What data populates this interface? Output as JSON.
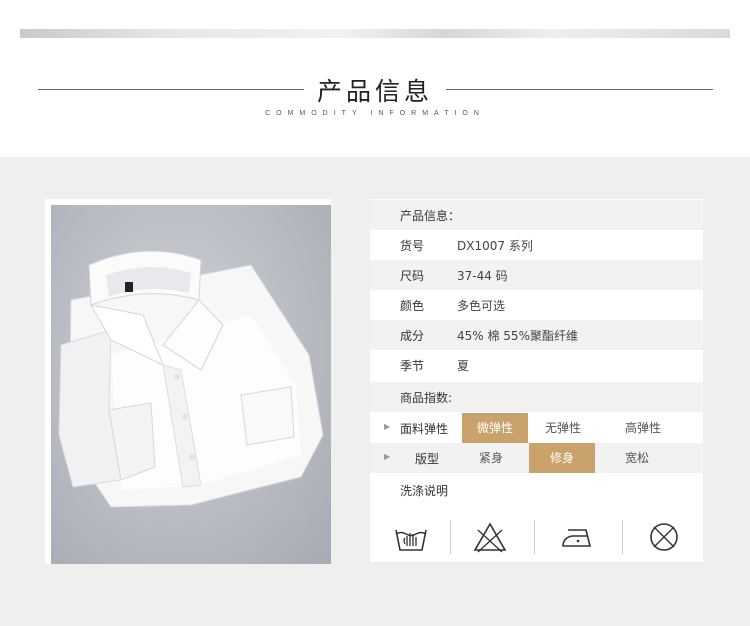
{
  "header": {
    "title": "产品信息",
    "subtitle": "COMMODITY INFORMATION"
  },
  "info": {
    "heading": "产品信息：",
    "rows": [
      {
        "label": "货号",
        "value": "DX1007  系列"
      },
      {
        "label": "尺码",
        "value": "37-44  码"
      },
      {
        "label": "颜色",
        "value": "多色可选"
      },
      {
        "label": "成分",
        "value": "45%  棉    55%聚酯纤维"
      },
      {
        "label": "季节",
        "value": "夏"
      }
    ]
  },
  "index": {
    "heading": "商品指数:",
    "elasticity": {
      "label": "面料弹性",
      "options": [
        "微弹性",
        "无弹性",
        "高弹性"
      ],
      "selected": "微弹性"
    },
    "fit": {
      "label": "版型",
      "options": [
        "紧身",
        "修身",
        "宽松"
      ],
      "selected": "修身"
    }
  },
  "care": {
    "heading": "洗涤说明",
    "icons": [
      "hand-wash-icon",
      "no-bleach-icon",
      "iron-icon",
      "no-tumble-dry-icon"
    ]
  },
  "colors": {
    "accent": "#c9a36b",
    "band": "#efefef"
  }
}
